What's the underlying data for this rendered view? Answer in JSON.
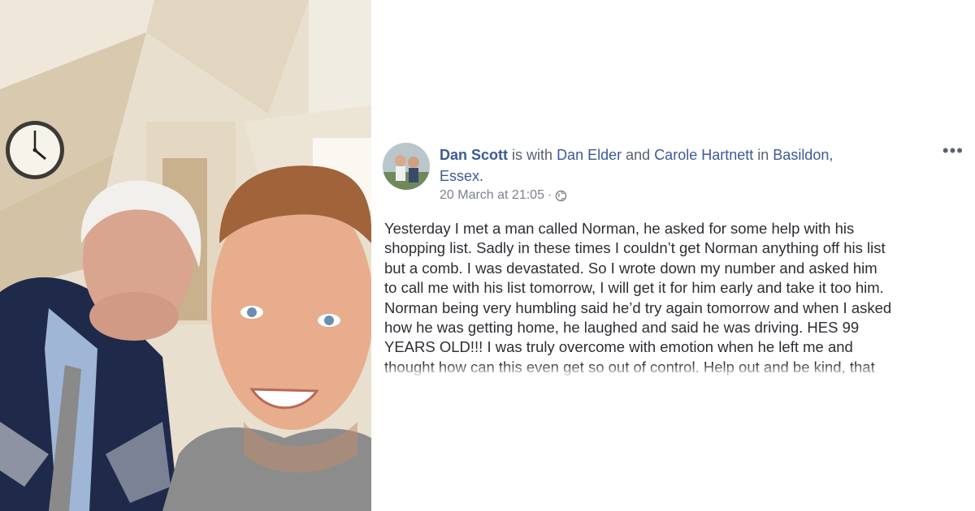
{
  "post": {
    "author": "Dan Scott",
    "with_text": "is with",
    "tagged": [
      "Dan Elder",
      "Carole Hartnett"
    ],
    "and_text": "and",
    "in_text": "in",
    "location_line1": "Basildon,",
    "location_line2": "Essex.",
    "timestamp": "20 March at 21:05",
    "separator": "·",
    "privacy_icon": "globe-icon",
    "more_icon": "•••",
    "body_lines": [
      "Yesterday I met a man called Norman, he asked for some help with his",
      "shopping list. Sadly in these times I couldn’t get Norman anything off his list",
      "but a comb. I was devastated. So I wrote down my number and asked him",
      "to call me with his list tomorrow, I will get it for him early and take it too him.",
      "Norman being very humbling said he’d try again tomorrow and when I asked",
      "how he was getting home, he laughed and said he was driving. HES 99",
      "YEARS OLD!!! I was truly overcome with emotion when he left me and",
      "thought how can this even get so out of control. Help out and be kind, that"
    ]
  },
  "colors": {
    "link": "#3b5a98",
    "text": "#2b2e33",
    "meta": "#7b818d"
  }
}
